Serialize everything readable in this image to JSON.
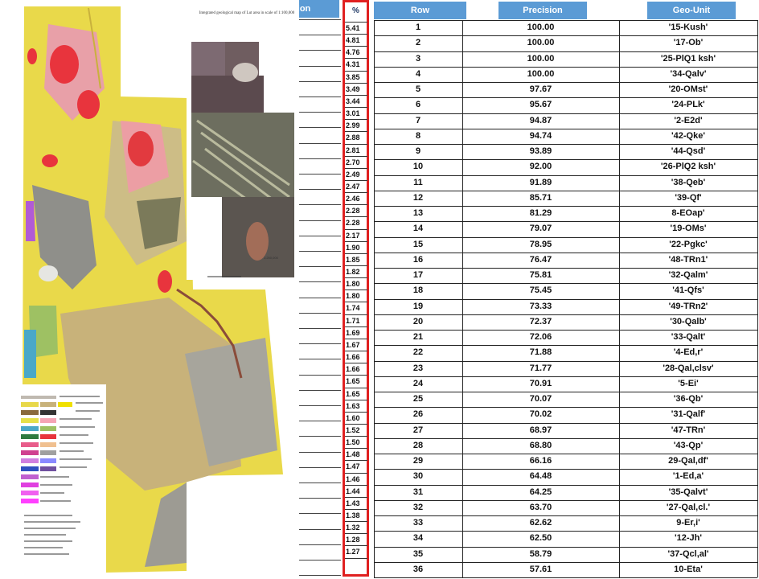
{
  "map": {
    "title": "Integrated geological map of Lut area in scale of 1:100,000",
    "scale": "1:250,000"
  },
  "left_header": "ation",
  "percent": {
    "header": "%",
    "values": [
      "5.41",
      "4.81",
      "4.76",
      "4.31",
      "3.85",
      "3.49",
      "3.44",
      "3.01",
      "2.99",
      "2.88",
      "2.81",
      "2.70",
      "2.49",
      "2.47",
      "2.46",
      "2.28",
      "2.28",
      "2.17",
      "1.90",
      "1.85",
      "1.82",
      "1.80",
      "1.80",
      "1.74",
      "1.71",
      "1.69",
      "1.67",
      "1.66",
      "1.66",
      "1.65",
      "1.65",
      "1.63",
      "1.60",
      "1.52",
      "1.50",
      "1.48",
      "1.47",
      "1.46",
      "1.44",
      "1.43",
      "1.38",
      "1.32",
      "1.28",
      "1.27"
    ]
  },
  "table": {
    "headers": {
      "row": "Row",
      "precision": "Precision",
      "geo_unit": "Geo-Unit"
    },
    "rows": [
      {
        "row": "1",
        "precision": "100.00",
        "unit": "'15-Kush'"
      },
      {
        "row": "2",
        "precision": "100.00",
        "unit": "'17-Ob'"
      },
      {
        "row": "3",
        "precision": "100.00",
        "unit": "'25-PlQ1 ksh'"
      },
      {
        "row": "4",
        "precision": "100.00",
        "unit": "'34-Qalv'"
      },
      {
        "row": "5",
        "precision": "97.67",
        "unit": "'20-OMst'"
      },
      {
        "row": "6",
        "precision": "95.67",
        "unit": "'24-PLk'"
      },
      {
        "row": "7",
        "precision": "94.87",
        "unit": "'2-E2d'"
      },
      {
        "row": "8",
        "precision": "94.74",
        "unit": "'42-Qke'"
      },
      {
        "row": "9",
        "precision": "93.89",
        "unit": "'44-Qsd'"
      },
      {
        "row": "10",
        "precision": "92.00",
        "unit": "'26-PlQ2 ksh'"
      },
      {
        "row": "11",
        "precision": "91.89",
        "unit": "'38-Qeb'"
      },
      {
        "row": "12",
        "precision": "85.71",
        "unit": "'39-Qf'"
      },
      {
        "row": "13",
        "precision": "81.29",
        "unit": "8-EOap'"
      },
      {
        "row": "14",
        "precision": "79.07",
        "unit": "'19-OMs'"
      },
      {
        "row": "15",
        "precision": "78.95",
        "unit": "'22-Pgkc'"
      },
      {
        "row": "16",
        "precision": "76.47",
        "unit": "'48-TRn1'"
      },
      {
        "row": "17",
        "precision": "75.81",
        "unit": "'32-Qalm'"
      },
      {
        "row": "18",
        "precision": "75.45",
        "unit": "'41-Qfs'"
      },
      {
        "row": "19",
        "precision": "73.33",
        "unit": "'49-TRn2'"
      },
      {
        "row": "20",
        "precision": "72.37",
        "unit": "'30-Qalb'"
      },
      {
        "row": "21",
        "precision": "72.06",
        "unit": "'33-Qalt'"
      },
      {
        "row": "22",
        "precision": "71.88",
        "unit": "'4-Ed,r'"
      },
      {
        "row": "23",
        "precision": "71.77",
        "unit": "'28-Qal,clsv'"
      },
      {
        "row": "24",
        "precision": "70.91",
        "unit": "'5-Ei'"
      },
      {
        "row": "25",
        "precision": "70.07",
        "unit": "'36-Qb'"
      },
      {
        "row": "26",
        "precision": "70.02",
        "unit": "'31-Qalf'"
      },
      {
        "row": "27",
        "precision": "68.97",
        "unit": "'47-TRn'"
      },
      {
        "row": "28",
        "precision": "68.80",
        "unit": "'43-Qp'"
      },
      {
        "row": "29",
        "precision": "66.16",
        "unit": "29-Qal,df'"
      },
      {
        "row": "30",
        "precision": "64.48",
        "unit": "'1-Ed,a'"
      },
      {
        "row": "31",
        "precision": "64.25",
        "unit": "'35-Qalvt'"
      },
      {
        "row": "32",
        "precision": "63.70",
        "unit": "'27-Qal,cl.'"
      },
      {
        "row": "33",
        "precision": "62.62",
        "unit": "9-Er,i'"
      },
      {
        "row": "34",
        "precision": "62.50",
        "unit": "'12-Jh'"
      },
      {
        "row": "35",
        "precision": "58.79",
        "unit": "'37-Qcl,al'"
      },
      {
        "row": "36",
        "precision": "57.61",
        "unit": "10-Eta'"
      }
    ]
  },
  "colors": {
    "header_blue": "#5b9bd5",
    "highlight_red": "#e02020"
  }
}
